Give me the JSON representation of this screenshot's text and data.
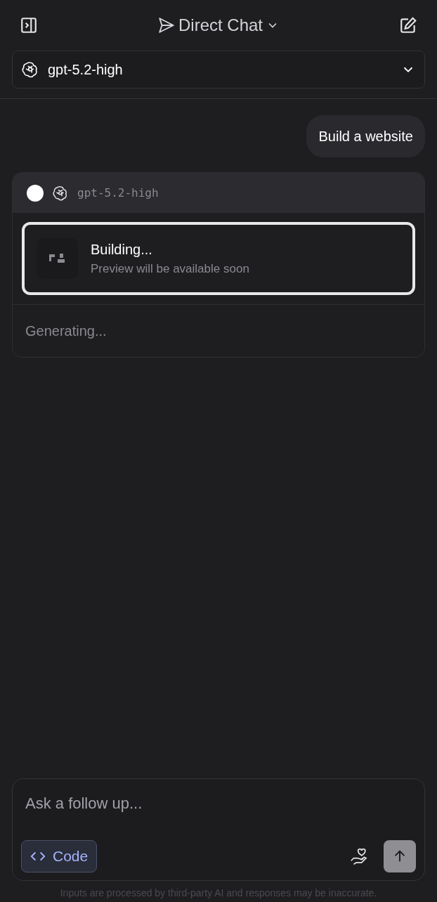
{
  "header": {
    "title": "Direct Chat"
  },
  "model_selector": {
    "value": "gpt-5.2-high"
  },
  "messages": [
    {
      "kind": "user",
      "text": "Build a website"
    },
    {
      "kind": "assistant",
      "model": "gpt-5.2-high",
      "build": {
        "title": "Building...",
        "subtitle": "Preview will be available soon"
      },
      "status": "Generating..."
    }
  ],
  "composer": {
    "placeholder": "Ask a follow up...",
    "mode_button": {
      "label": "Code",
      "on": true
    }
  },
  "disclaimer": "Inputs are processed by third-party AI and responses may be inaccurate."
}
